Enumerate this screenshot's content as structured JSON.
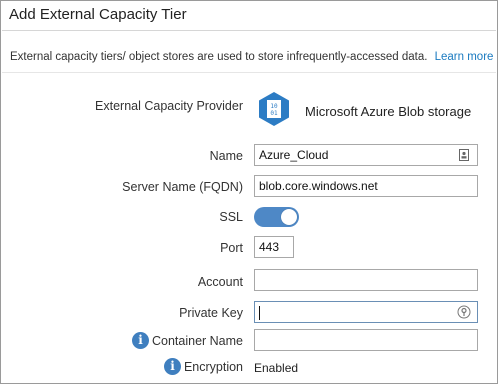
{
  "dialog": {
    "title": "Add External Capacity Tier"
  },
  "description": {
    "text": "External capacity tiers/ object stores are used to store infrequently-accessed data.",
    "link": "Learn more"
  },
  "provider": {
    "label": "External Capacity Provider",
    "value": "Microsoft Azure Blob storage",
    "icon": "azure-blob-storage-icon",
    "icon_text_top": "10",
    "icon_text_bottom": "01"
  },
  "fields": {
    "name": {
      "label": "Name",
      "value": "Azure_Cloud",
      "icon": "contact-card-icon"
    },
    "server": {
      "label": "Server Name (FQDN)",
      "value": "blob.core.windows.net"
    },
    "ssl": {
      "label": "SSL",
      "enabled": true
    },
    "port": {
      "label": "Port",
      "value": "443"
    },
    "account": {
      "label": "Account",
      "value": ""
    },
    "private_key": {
      "label": "Private Key",
      "value": "",
      "icon": "reveal-key-icon"
    },
    "container_name": {
      "label": "Container Name",
      "value": "",
      "info_icon": "info-icon"
    },
    "encryption": {
      "label": "Encryption",
      "value": "Enabled",
      "info_icon": "info-icon"
    }
  },
  "colors": {
    "accent": "#4e88c6",
    "link": "#1a7ac0",
    "info": "#3f7fbf"
  }
}
